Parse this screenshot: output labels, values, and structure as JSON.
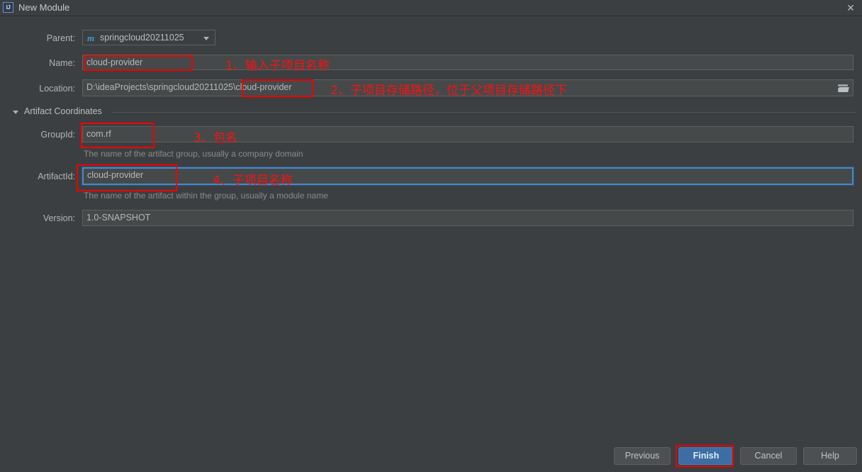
{
  "window": {
    "title": "New Module",
    "app_icon_label": "IJ",
    "close_icon": "close-icon",
    "background": "#3c3f41"
  },
  "form": {
    "parent": {
      "label": "Parent:",
      "value": "springcloud20211025",
      "icon": "maven-module-icon",
      "icon_glyph": "m"
    },
    "name": {
      "label": "Name:",
      "value": "cloud-provider"
    },
    "location": {
      "label": "Location:",
      "value": "D:\\ideaProjects\\springcloud20211025\\cloud-provider",
      "browse_icon": "folder-icon"
    },
    "section": {
      "label": "Artifact Coordinates",
      "expanded_icon": "triangle-down-icon"
    },
    "group_id": {
      "label": "GroupId:",
      "value": "com.rf",
      "hint": "The name of the artifact group, usually a company domain"
    },
    "artifact_id": {
      "label": "ArtifactId:",
      "value": "cloud-provider",
      "hint": "The name of the artifact within the group, usually a module name",
      "focused": true,
      "focus_color": "#4a88c7"
    },
    "version": {
      "label": "Version:",
      "value": "1.0-SNAPSHOT"
    }
  },
  "buttons": {
    "previous": "Previous",
    "finish": "Finish",
    "cancel": "Cancel",
    "help": "Help",
    "primary_color": "#3c6ea5"
  },
  "annotations": {
    "color": "#fc1111",
    "items": [
      {
        "text": "1、输入子项目名称"
      },
      {
        "text": "2、子项目存储路径，位于父项目存储路径下"
      },
      {
        "text": "3、包名"
      },
      {
        "text": "4、子项目名称"
      }
    ]
  }
}
